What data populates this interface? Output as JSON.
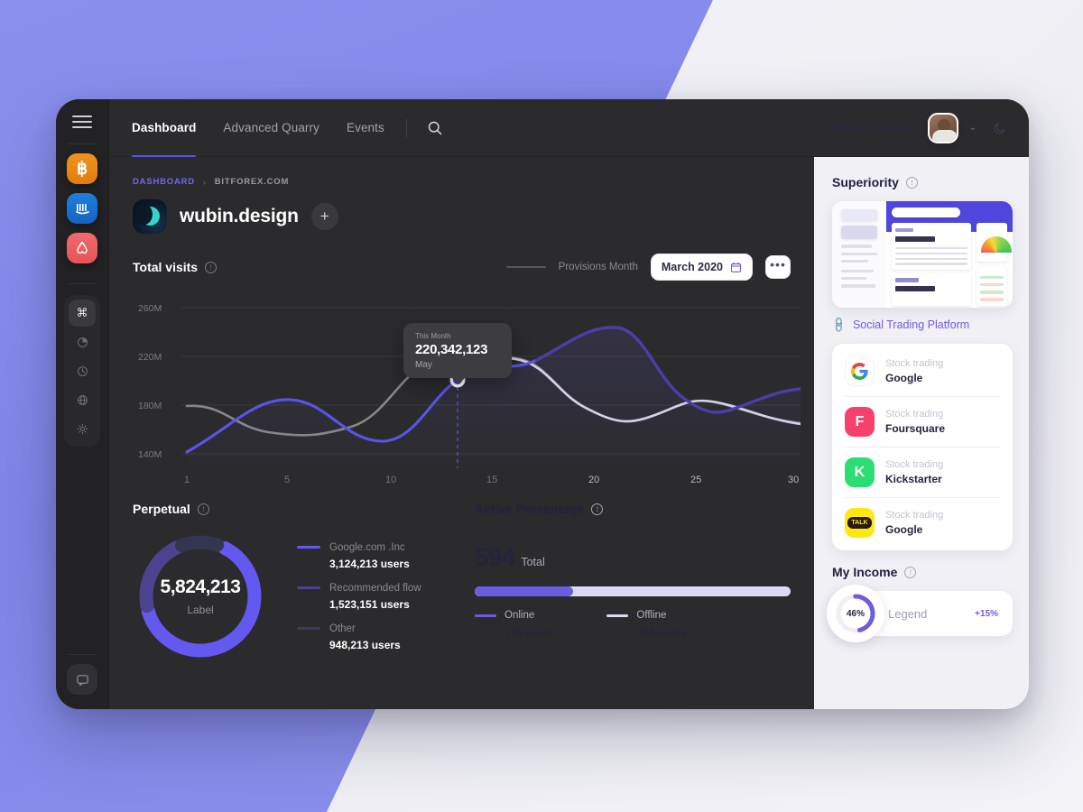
{
  "theme": {
    "bg_purple": "#8086e9",
    "bg_light": "#f0f0f5",
    "panel_dark": "#2b2b2d",
    "rail_dark": "#222224",
    "accent": "#5b54e8",
    "accent_light": "#6c5ce0"
  },
  "rail": {
    "menu_icon": "hamburger-icon",
    "brands": [
      {
        "name": "bitcoin",
        "glyph": "฿",
        "color": "#f0931e"
      },
      {
        "name": "barcode",
        "glyph": "",
        "color": "#1f7fdd"
      },
      {
        "name": "airbnb",
        "glyph": "",
        "color": "#f16a6a"
      }
    ],
    "tools": [
      {
        "name": "command-icon",
        "glyph": "⌘",
        "active": true
      },
      {
        "name": "pie-chart-icon",
        "glyph": "◔",
        "active": false
      },
      {
        "name": "clock-icon",
        "glyph": "◷",
        "active": false
      },
      {
        "name": "globe-icon",
        "glyph": "⊕",
        "active": false
      },
      {
        "name": "settings-icon",
        "glyph": "☀",
        "active": false
      }
    ],
    "chat_icon": "chat-icon"
  },
  "topbar": {
    "nav": [
      {
        "label": "Dashboard",
        "active": true
      },
      {
        "label": "Advanced Quarry",
        "active": false
      },
      {
        "label": "Events",
        "active": false
      }
    ],
    "search_icon": "search-icon",
    "user_name": "Bessie Cooper",
    "caret": "⌄",
    "moon_icon": "moon-icon"
  },
  "breadcrumb": {
    "first": "DASHBOARD",
    "separator": "›",
    "second": "BITFOREX.COM"
  },
  "workspace": {
    "title": "wubin.design",
    "add_label": "+"
  },
  "total_visits": {
    "title": "Total visits",
    "legend_label": "Provisions Month",
    "date_value": "March 2020",
    "calendar_icon": "calendar-icon",
    "more_label": "•••",
    "tooltip": {
      "caption": "This Month",
      "value": "220,342,123",
      "month": "May"
    }
  },
  "perpetual": {
    "title": "Perpetual",
    "center_value": "5,824,213",
    "center_label": "Label",
    "legend": [
      {
        "name": "Google.com .Inc",
        "value": "3,124,213 users",
        "color": "#6358ef"
      },
      {
        "name": "Recommended flow",
        "value": "1,523,151 users",
        "color": "#4b438f"
      },
      {
        "name": "Other",
        "value": "948,213 users",
        "color": "#3b3b5a"
      }
    ]
  },
  "active_percentage": {
    "title": "Active Percentage",
    "total_value": "594",
    "total_label": "Total",
    "progress_percent": 31,
    "legend": [
      {
        "name": "Online",
        "value": "179 users",
        "color": "#6c5ce0"
      },
      {
        "name": "Offline",
        "value": "394 users",
        "color": "#dcd8f7"
      }
    ]
  },
  "superiority": {
    "title": "Superiority",
    "link_icon": "link-icon",
    "link_text": "Social Trading Platform",
    "cards": [
      {
        "caption": "Stock trading",
        "name": "Google",
        "logo": "google-icon",
        "glyph": "G"
      },
      {
        "caption": "Stock trading",
        "name": "Foursquare",
        "logo": "foursquare-icon",
        "glyph": "F"
      },
      {
        "caption": "Stock trading",
        "name": "Kickstarter",
        "logo": "kickstarter-icon",
        "glyph": "K"
      },
      {
        "caption": "Stock trading",
        "name": "Google",
        "logo": "kakaotalk-icon",
        "glyph": "TALK"
      }
    ]
  },
  "my_income": {
    "title": "My Income",
    "percent_label": "46%",
    "legend_label": "Legend",
    "delta_label": "+15%",
    "percent_value": 46
  },
  "chart_data": {
    "type": "line",
    "title": "Total visits",
    "xlabel": "",
    "ylabel": "",
    "x": [
      1,
      5,
      10,
      15,
      20,
      25,
      30
    ],
    "xtick_labels": [
      "1",
      "5",
      "10",
      "15",
      "20",
      "25",
      "30"
    ],
    "ytick_labels": [
      "260M",
      "220M",
      "180M",
      "140M"
    ],
    "ylim": [
      120,
      280
    ],
    "grid": true,
    "legend_position": "top-right",
    "series": [
      {
        "name": "This Month",
        "color": "#5b54e8",
        "values": [
          146,
          178,
          172,
          160,
          213,
          220,
          252,
          238,
          200,
          196,
          213
        ]
      },
      {
        "name": "Provisions Month",
        "color": "#8c8c94",
        "values": [
          184,
          176,
          162,
          178,
          219,
          221,
          196,
          165,
          158,
          180,
          166
        ]
      }
    ],
    "highlight_point": {
      "x_index": 13,
      "label": "May",
      "value": "220,342,123"
    }
  }
}
